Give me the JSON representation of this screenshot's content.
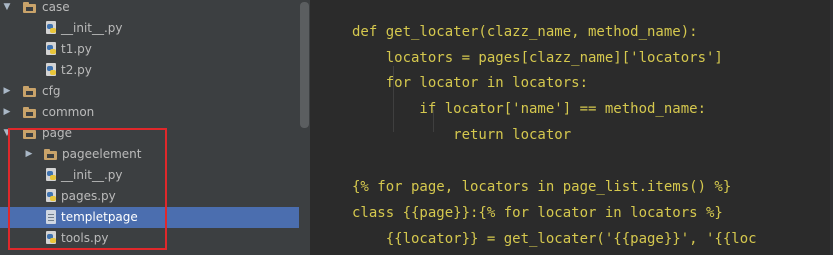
{
  "tree": {
    "items": [
      {
        "id": "case",
        "label": "case",
        "kind": "folder",
        "expanded": true
      },
      {
        "id": "case-init",
        "label": "__init__.py",
        "kind": "py"
      },
      {
        "id": "case-t1",
        "label": "t1.py",
        "kind": "py"
      },
      {
        "id": "case-t2",
        "label": "t2.py",
        "kind": "py"
      },
      {
        "id": "cfg",
        "label": "cfg",
        "kind": "folder",
        "expanded": false
      },
      {
        "id": "common",
        "label": "common",
        "kind": "folder",
        "expanded": false
      },
      {
        "id": "page",
        "label": "page",
        "kind": "folder",
        "expanded": true
      },
      {
        "id": "pageelement",
        "label": "pageelement",
        "kind": "folder",
        "expanded": false
      },
      {
        "id": "page-init",
        "label": "__init__.py",
        "kind": "py"
      },
      {
        "id": "pages",
        "label": "pages.py",
        "kind": "py"
      },
      {
        "id": "templetpage",
        "label": "templetpage",
        "kind": "text",
        "selected": true
      },
      {
        "id": "tools",
        "label": "tools.py",
        "kind": "py"
      }
    ]
  },
  "editor": {
    "lines": [
      "def get_locater(clazz_name, method_name):",
      "    locators = pages[clazz_name]['locators']",
      "    for locator in locators:",
      "        if locator['name'] == method_name:",
      "            return locator",
      "",
      "{% for page, locators in page_list.items() %}",
      "class {{page}}:{% for locator in locators %}",
      "    {{locator}} = get_locater('{{page}}', '{{loc"
    ]
  },
  "colors": {
    "tree_bg": "#3c3f41",
    "editor_bg": "#2b2b2b",
    "selection": "#4b6eaf",
    "code_text": "#d5c84e",
    "highlight_box": "#e0282b",
    "folder": "#c9a36a"
  }
}
